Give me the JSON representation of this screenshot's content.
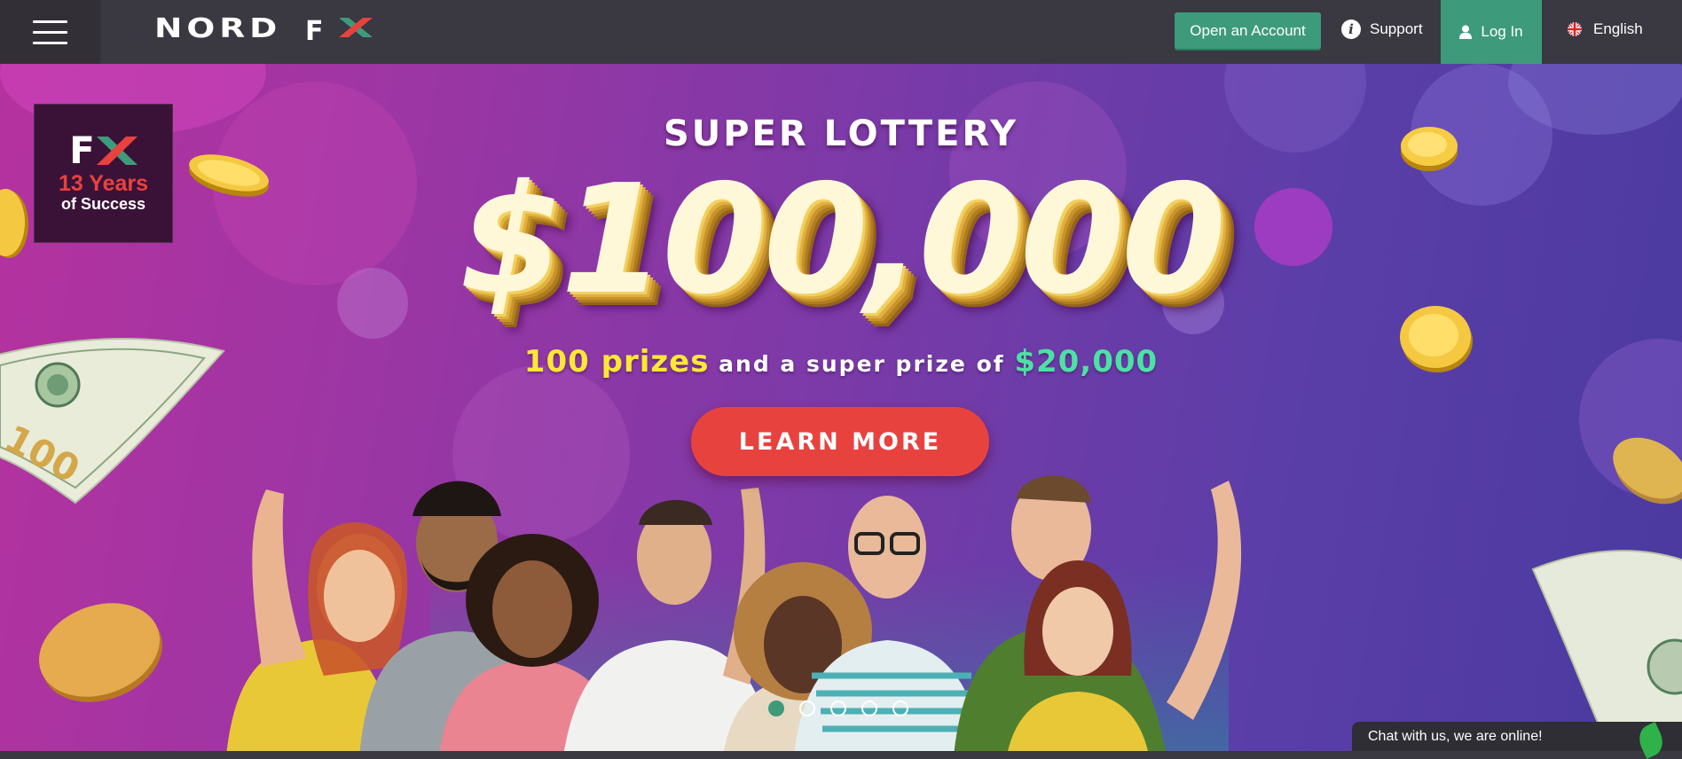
{
  "header": {
    "logo_text": "NORD FX",
    "logo_word": "NORD",
    "logo_f": "F",
    "open_account_label": "Open an Account",
    "support_label": "Support",
    "login_label": "Log In",
    "language_label": "English"
  },
  "icons": {
    "menu": "hamburger-menu-icon",
    "support": "info-icon",
    "login": "user-icon",
    "language": "uk-flag-icon",
    "chat": "leaf-icon"
  },
  "colors": {
    "topbar": "#3a3840",
    "accent_green": "#3d9b7c",
    "cta_red": "#e8423f",
    "highlight_yellow": "#ffe835",
    "highlight_green": "#4ee0a5"
  },
  "badge": {
    "mark": "FX",
    "years": "13 Years",
    "success": "of Success"
  },
  "hero": {
    "title": "SUPER LOTTERY",
    "amount": "$100,000",
    "subline_prefix": "100 prizes",
    "subline_middle": " and a super prize of ",
    "subline_value": "$20,000",
    "cta_label": "LEARN MORE"
  },
  "carousel": {
    "total_slides": 5,
    "active_slide": 1
  },
  "chat": {
    "label": "Chat with us, we are online!"
  }
}
